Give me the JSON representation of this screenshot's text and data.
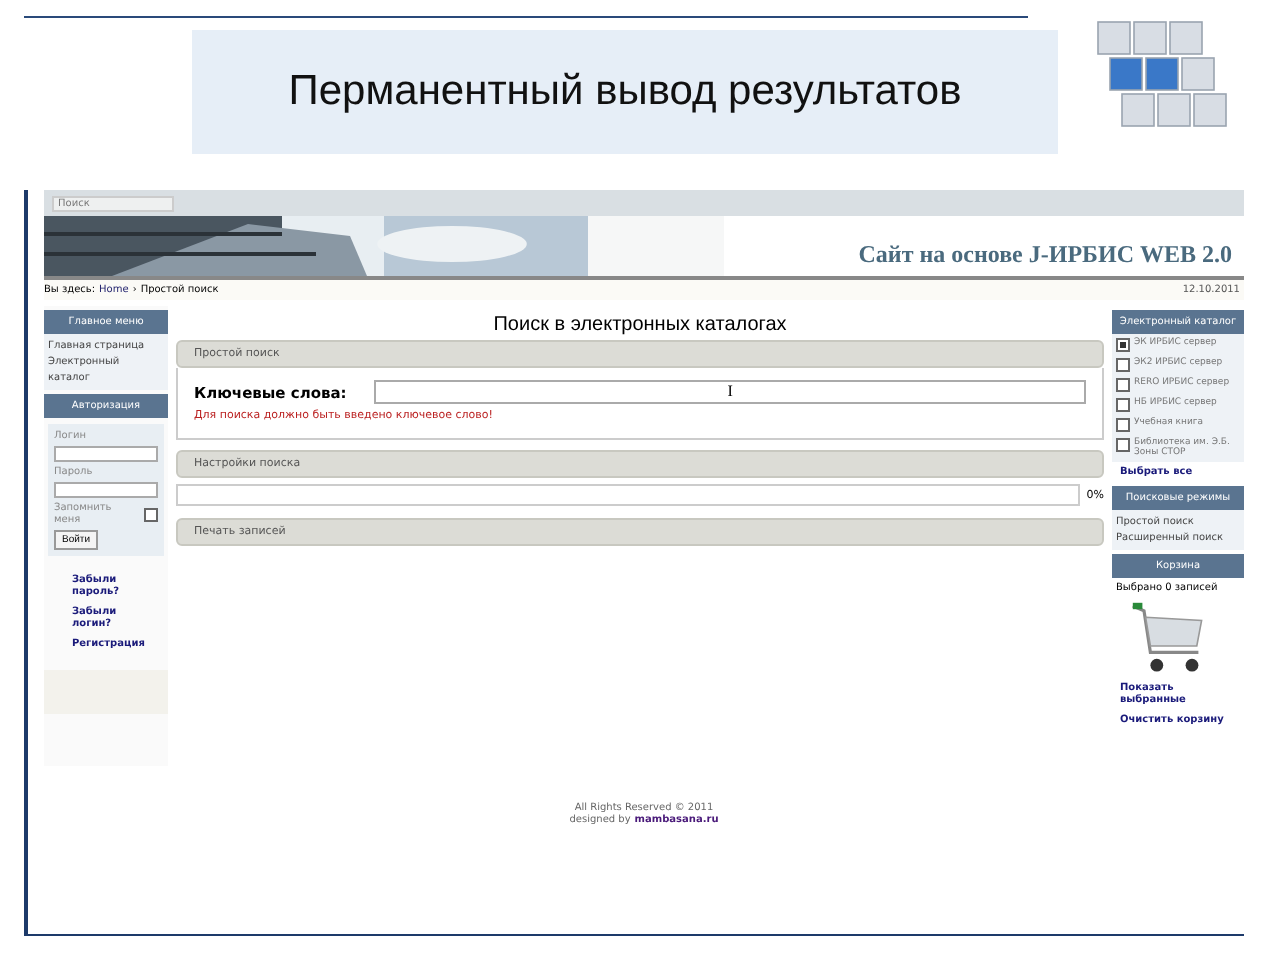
{
  "slide": {
    "title": "Перманентный вывод результатов"
  },
  "site": {
    "search_label": "Поиск",
    "site_title": "Сайт на основе J-ИРБИС WEB 2.0",
    "breadcrumb": [
      {
        "text": "Вы здесь:",
        "link": false
      },
      {
        "text": "Home",
        "link": true
      },
      {
        "text": "›",
        "link": false
      },
      {
        "text": "Простой поиск",
        "link": false
      }
    ],
    "date": "12.10.2011",
    "main_menu": {
      "title": "Главное меню",
      "items": [
        "Главная страница",
        "Электронный каталог"
      ]
    },
    "login": {
      "title": "Авторизация",
      "fields": [
        {
          "label": "Логин"
        },
        {
          "label": "Пароль"
        }
      ],
      "remember": {
        "label": "Запомнить меня",
        "checked": false
      },
      "button": "Войти",
      "links": [
        "Забыли пароль?",
        "Забыли логин?",
        "Регистрация"
      ]
    },
    "page_heading": "Поиск в электронных каталогах",
    "sections": [
      {
        "kind": "search",
        "title": "Простой поиск",
        "field_label": "Ключевые слова:",
        "value": "I",
        "hint": "Для поиска должно быть введено ключевое слово!"
      },
      {
        "kind": "progress",
        "title": "Настройки поиска",
        "level": 0,
        "reading": "0%"
      },
      {
        "kind": "plain",
        "title": "Печать записей"
      }
    ],
    "catalogs": {
      "title": "Электронный каталог",
      "items": [
        {
          "label": "ЭК ИРБИС сервер",
          "checked": true
        },
        {
          "label": "ЭК2 ИРБИС сервер",
          "checked": false
        },
        {
          "label": "RERO ИРБИС сервер",
          "checked": false
        },
        {
          "label": "НБ ИРБИС сервер",
          "checked": false
        },
        {
          "label": "Учебная книга",
          "checked": false
        },
        {
          "label": "Библиотека им. Э.Б. Зоны СТОР",
          "checked": false
        }
      ],
      "select_all": "Выбрать все"
    },
    "modes": {
      "title": "Поисковые режимы",
      "items": [
        "Простой поиск",
        "Расширенный поиск"
      ]
    },
    "cart": {
      "title": "Корзина",
      "count": "Выбрано 0 записей",
      "links": [
        "Показать выбранные",
        "Очистить корзину"
      ]
    },
    "footer": {
      "rights": "All Rights Reserved © 2011",
      "designed_by": "designed by",
      "designer": "mambasana.ru"
    }
  }
}
